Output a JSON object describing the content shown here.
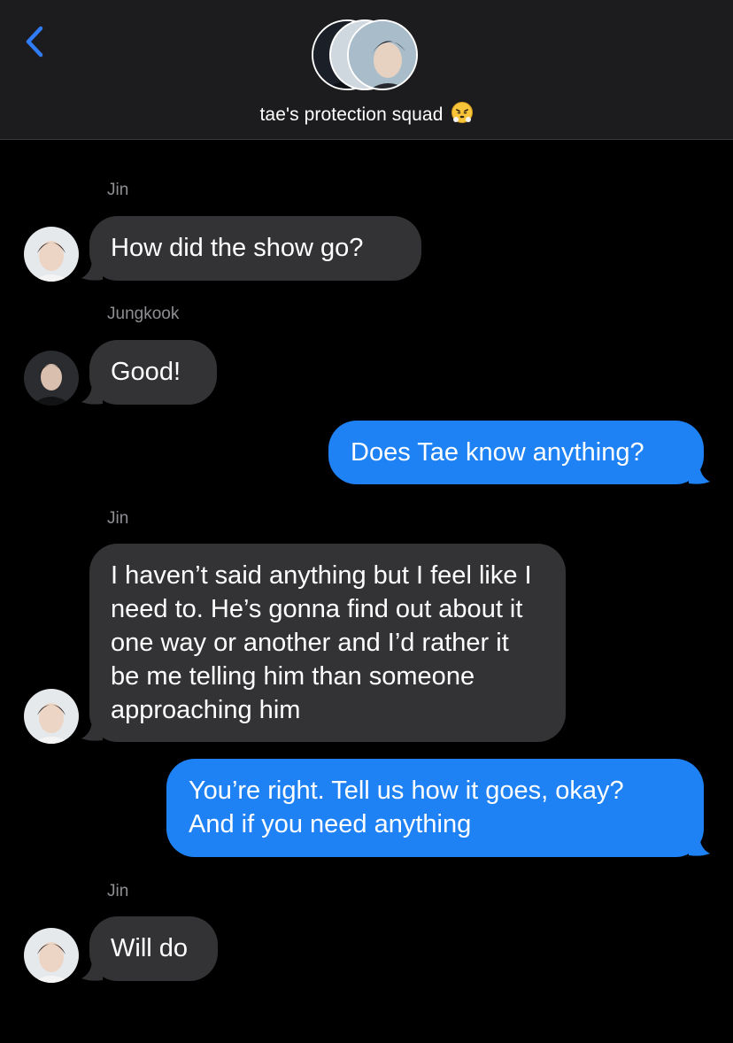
{
  "header": {
    "back_icon": "chevron-left-icon",
    "title": "tae's protection squad",
    "title_emoji": "face-with-steam-from-nose-icon",
    "accent_color": "#2f7cf6"
  },
  "messages": [
    {
      "id": "m1",
      "direction": "incoming",
      "sender": "Jin",
      "text": "How did the show go?"
    },
    {
      "id": "m2",
      "direction": "incoming",
      "sender": "Jungkook",
      "text": "Good!"
    },
    {
      "id": "m3",
      "direction": "outgoing",
      "text": "Does Tae know anything?"
    },
    {
      "id": "m4",
      "direction": "incoming",
      "sender": "Jin",
      "text": "I haven’t said anything but I feel like I need to. He’s gonna find out about it one way or another and I’d rather it be me telling him than someone approaching him"
    },
    {
      "id": "m5",
      "direction": "outgoing",
      "text": "You’re right. Tell us how it goes, okay? And if you need anything"
    },
    {
      "id": "m6",
      "direction": "incoming",
      "sender": "Jin",
      "text": "Will do"
    }
  ],
  "colors": {
    "incoming_bubble": "#333336",
    "outgoing_bubble": "#1e82f5",
    "sender_label": "#8e8e93",
    "header_bg": "#1c1c1e"
  }
}
